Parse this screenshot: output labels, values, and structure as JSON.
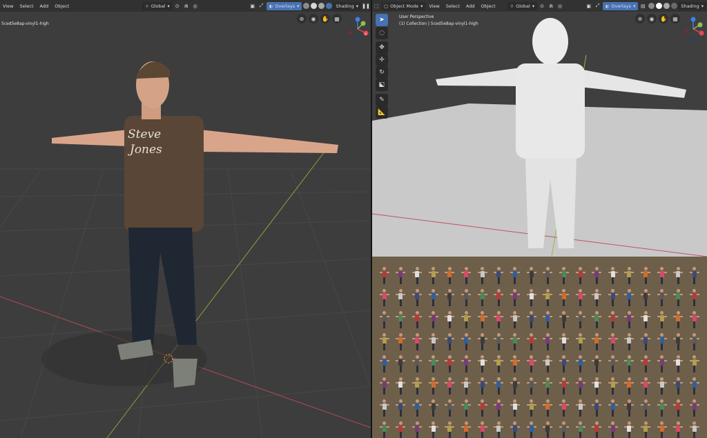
{
  "left_editor": {
    "menus": [
      "View",
      "Select",
      "Add",
      "Object"
    ],
    "transform_orientation": "Global",
    "overlays_label": "Overlays",
    "shading_label": "Shading",
    "object_name": "5ced5e8ap-vinyl1-high"
  },
  "right_editor": {
    "mode_label": "Object Mode",
    "menus": [
      "View",
      "Select",
      "Add",
      "Object"
    ],
    "transform_orientation": "Global",
    "overlays_label": "Overlays",
    "shading_label": "Shading",
    "perspective_label": "User Perspective",
    "collection_label": "(1) Collection | 5ced5e8ap-vinyl1-high"
  },
  "gizmo": {
    "x_label": "X",
    "y_label": "Y",
    "z_label": "Z"
  },
  "colors": {
    "accent": "#4772b3",
    "axis_x": "#e8455b",
    "axis_y": "#8bc34a",
    "axis_z": "#3f7ee8",
    "thumbnail_bg": "#6e5f4a"
  },
  "icons": {
    "editor_type": "viewport-icon",
    "selection_mode": "select-box-icon",
    "snapping": "magnet-icon",
    "proportional": "proportional-edit-icon",
    "overlays": "overlays-icon",
    "shading_modes": [
      "wireframe-icon",
      "solid-icon",
      "material-icon",
      "rendered-icon"
    ],
    "nav": [
      "zoom-icon",
      "camera-icon",
      "hand-pan-icon",
      "grid-icon"
    ],
    "tools": [
      "select-box-icon",
      "cursor-icon",
      "move-icon",
      "rotate-icon",
      "scale-icon",
      "transform-icon",
      "annotate-icon",
      "measure-icon"
    ]
  },
  "thumbnail_shirt_colors": [
    "#b63a3a",
    "#3a4a7a",
    "#e0e0e0",
    "#3c3c3c",
    "#d26c2c",
    "#4a8a5a",
    "#c8c8c8",
    "#7a3a7a",
    "#2f5f9f",
    "#b0a04a",
    "#5a5a5a",
    "#d84a6a"
  ]
}
